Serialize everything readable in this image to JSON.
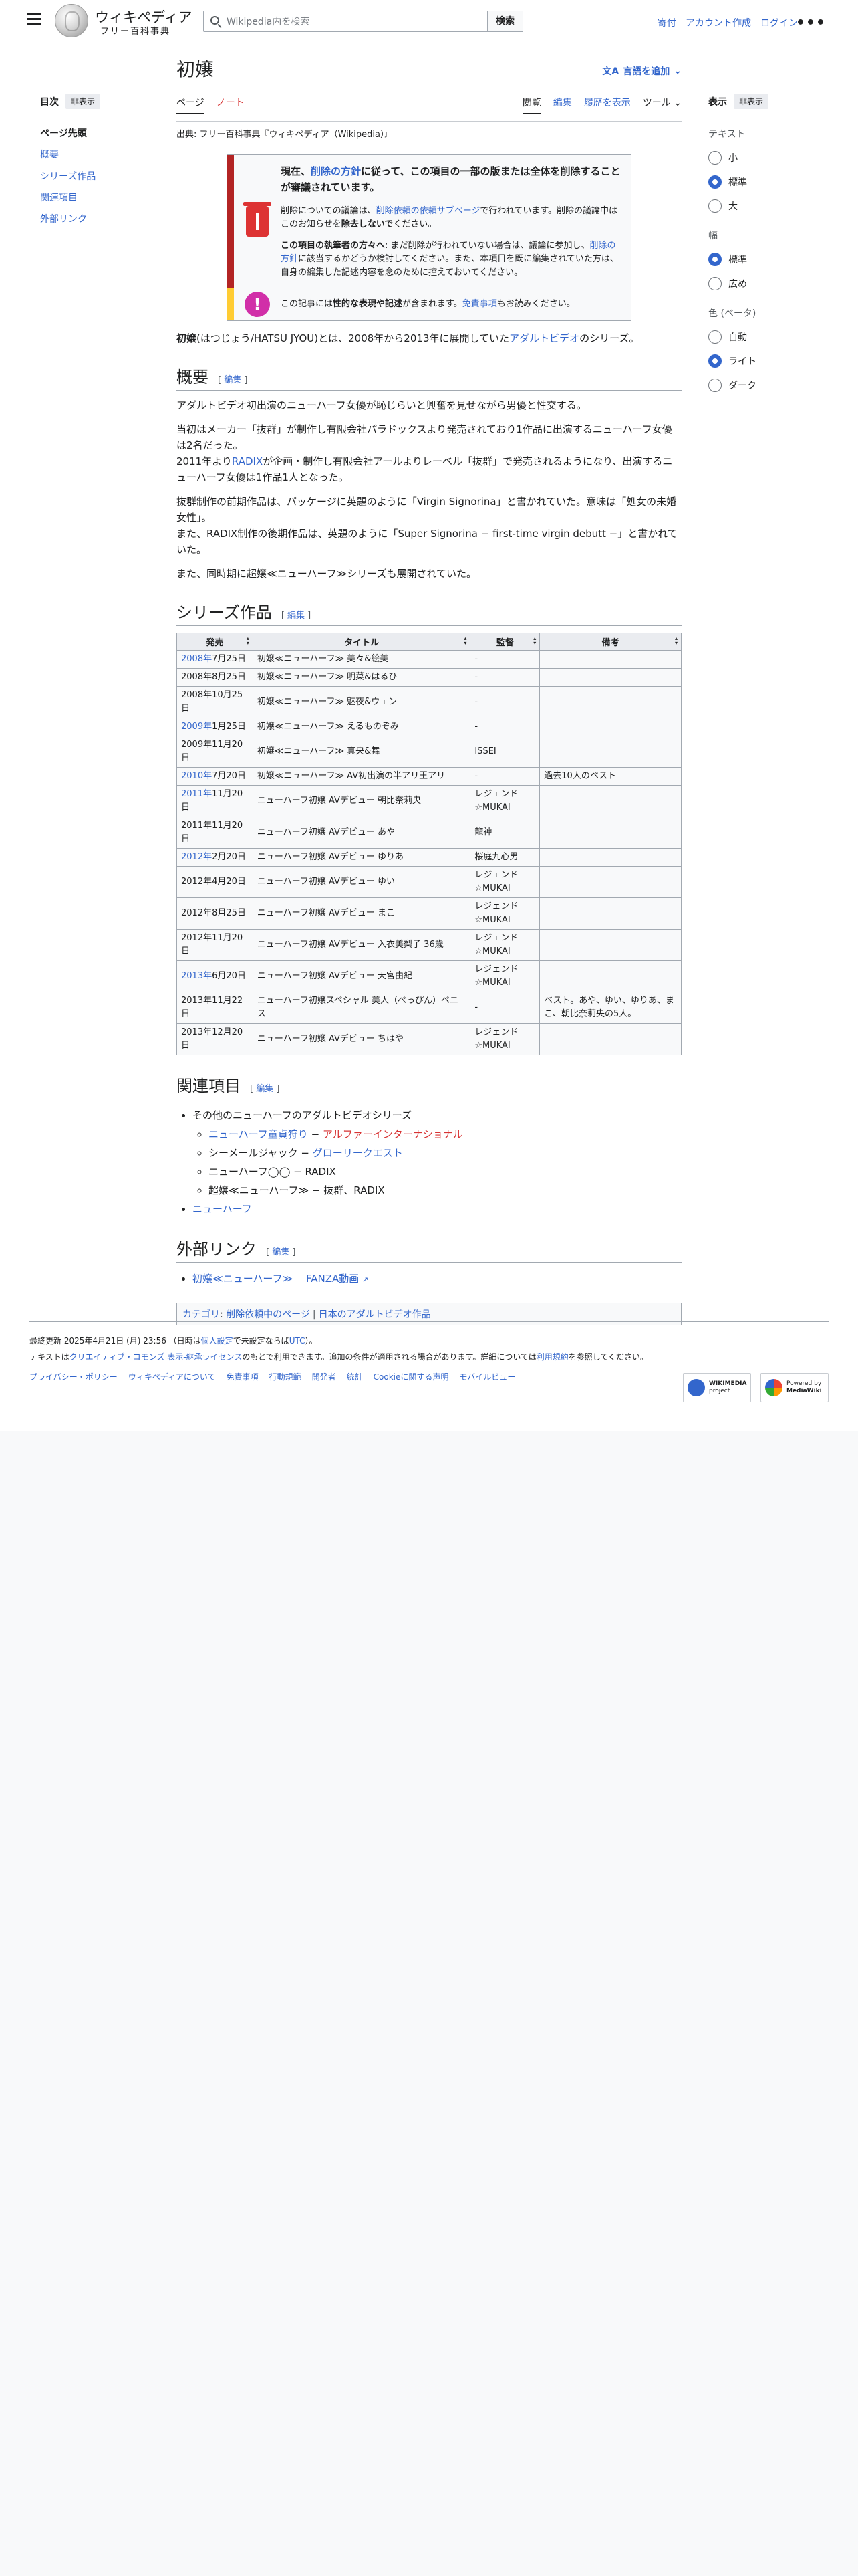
{
  "header": {
    "site_title": "ウィキペディア",
    "site_subtitle": "フリー百科事典",
    "search_placeholder": "Wikipedia内を検索",
    "search_button": "検索",
    "user_links": [
      "寄付",
      "アカウント作成",
      "ログイン"
    ]
  },
  "toc": {
    "title": "目次",
    "hide_label": "非表示",
    "items": [
      "ページ先頭",
      "概要",
      "シリーズ作品",
      "関連項目",
      "外部リンク"
    ]
  },
  "appearance": {
    "title": "表示",
    "hide_label": "非表示",
    "groups": [
      {
        "label": "テキスト",
        "options": [
          "小",
          "標準",
          "大"
        ],
        "selected": "標準"
      },
      {
        "label": "幅",
        "options": [
          "標準",
          "広め"
        ],
        "selected": "標準"
      },
      {
        "label": "色 (ベータ)",
        "options": [
          "自動",
          "ライト",
          "ダーク"
        ],
        "selected": "ライト"
      }
    ]
  },
  "page": {
    "title": "初嬢",
    "lang_button": "言語を追加",
    "tabs_left": [
      "ページ",
      "ノート"
    ],
    "tabs_right": [
      "閲覧",
      "編集",
      "履歴を表示",
      "ツール"
    ],
    "from_line": "出典: フリー百科事典『ウィキペディア（Wikipedia）』"
  },
  "notice": {
    "main_pre": "現在、",
    "main_link": "削除の方針",
    "main_post": "に従って、この項目の一部の版または全体を削除することが審議されています。",
    "p1_pre": "削除についての議論は、",
    "p1_link": "削除依頼の依頼サブページ",
    "p1_post": "で行われています。削除の議論中はこのお知らせを",
    "p1_bold": "除去しないで",
    "p1_end": "ください。",
    "p2_bold": "この項目の執筆者の方々へ",
    "p2_text": ": まだ削除が行われていない場合は、議論に参加し、",
    "p2_link": "削除の方針",
    "p2_end": "に該当するかどうか検討してください。また、本項目を既に編集されていた方は、自身の編集した記述内容を念のために控えておいてください。",
    "p3_pre": "この記事には",
    "p3_bold": "性的な表現や記述",
    "p3_mid": "が含まれます。",
    "p3_link": "免責事項",
    "p3_end": "もお読みください。"
  },
  "intro": {
    "bold": "初嬢",
    "text": "(はつじょう/HATSU JYOU)とは、2008年から2013年に展開していた",
    "link": "アダルトビデオ",
    "end": "のシリーズ。"
  },
  "overview": {
    "heading": "概要",
    "edit": "編集",
    "p1": "アダルトビデオ初出演のニューハーフ女優が恥じらいと興奮を見せながら男優と性交する。",
    "p2a": "当初はメーカー「抜群」が制作し有限会社パラドックスより発売されており1作品に出演するニューハーフ女優は2名だった。",
    "p2b_pre": "2011年より",
    "p2b_link": "RADIX",
    "p2b_post": "が企画・制作し有限会社アールよりレーベル「抜群」で発売されるようになり、出演するニューハーフ女優は1作品1人となった。",
    "p3a": "抜群制作の前期作品は、パッケージに英題のように「Virgin Signorina」と書かれていた。意味は「処女の未婚女性」。",
    "p3b": "また、RADIX制作の後期作品は、英題のように「Super Signorina − first-time virgin debutt −」と書かれていた。",
    "p4": "また、同時期に超嬢≪ニューハーフ≫シリーズも展開されていた。"
  },
  "series": {
    "heading": "シリーズ作品",
    "edit": "編集",
    "columns": [
      "発売",
      "タイトル",
      "監督",
      "備考"
    ],
    "rows": [
      {
        "year": "2008年",
        "year_link": true,
        "date": "7月25日",
        "title": "初嬢≪ニューハーフ≫ 美々&絵美",
        "director": "-",
        "note": ""
      },
      {
        "year": "",
        "year_link": false,
        "date": "2008年8月25日",
        "title": "初嬢≪ニューハーフ≫ 明菜&はるひ",
        "director": "-",
        "note": ""
      },
      {
        "year": "",
        "year_link": false,
        "date": "2008年10月25日",
        "title": "初嬢≪ニューハーフ≫ 魅夜&ウェン",
        "director": "-",
        "note": ""
      },
      {
        "year": "2009年",
        "year_link": true,
        "date": "1月25日",
        "title": "初嬢≪ニューハーフ≫ えるものぞみ",
        "director": "-",
        "note": ""
      },
      {
        "year": "",
        "year_link": false,
        "date": "2009年11月20日",
        "title": "初嬢≪ニューハーフ≫ 真央&舞",
        "director": "ISSEI",
        "note": ""
      },
      {
        "year": "2010年",
        "year_link": true,
        "date": "7月20日",
        "title": "初嬢≪ニューハーフ≫ AV初出演の半アリ王アリ",
        "director": "-",
        "note": "過去10人のベスト"
      },
      {
        "year": "2011年",
        "year_link": true,
        "date": "11月20日",
        "title": "ニューハーフ初嬢 AVデビュー 朝比奈莉央",
        "director": "レジェンド☆MUKAI",
        "note": ""
      },
      {
        "year": "",
        "year_link": false,
        "date": "2011年11月20日",
        "title": "ニューハーフ初嬢 AVデビュー あや",
        "director": "龍神",
        "note": ""
      },
      {
        "year": "2012年",
        "year_link": true,
        "date": "2月20日",
        "title": "ニューハーフ初嬢 AVデビュー ゆりあ",
        "director": "桜庭九心男",
        "note": ""
      },
      {
        "year": "",
        "year_link": false,
        "date": "2012年4月20日",
        "title": "ニューハーフ初嬢 AVデビュー ゆい",
        "director": "レジェンド☆MUKAI",
        "note": ""
      },
      {
        "year": "",
        "year_link": false,
        "date": "2012年8月25日",
        "title": "ニューハーフ初嬢 AVデビュー まこ",
        "director": "レジェンド☆MUKAI",
        "note": ""
      },
      {
        "year": "",
        "year_link": false,
        "date": "2012年11月20日",
        "title": "ニューハーフ初嬢 AVデビュー 入衣美梨子 36歳",
        "director": "レジェンド☆MUKAI",
        "note": ""
      },
      {
        "year": "2013年",
        "year_link": true,
        "date": "6月20日",
        "title": "ニューハーフ初嬢 AVデビュー 天宮由紀",
        "director": "レジェンド☆MUKAI",
        "note": ""
      },
      {
        "year": "",
        "year_link": false,
        "date": "2013年11月22日",
        "title": "ニューハーフ初嬢スペシャル 美人（ぺっぴん）ペニス",
        "director": "-",
        "note": "ベスト。あや、ゆい、ゆりあ、まこ、朝比奈莉央の5人。"
      },
      {
        "year": "",
        "year_link": false,
        "date": "2013年12月20日",
        "title": "ニューハーフ初嬢 AVデビュー ちはや",
        "director": "レジェンド☆MUKAI",
        "note": ""
      }
    ]
  },
  "related": {
    "heading": "関連項目",
    "edit": "編集",
    "item1": "その他のニューハーフのアダルトビデオシリーズ",
    "sub1_link": "ニューハーフ童貞狩り",
    "sub1_dash": " − ",
    "sub1_red": "アルファーインターナショナル",
    "sub2_text": "シーメールジャック − ",
    "sub2_link": "グローリークエスト",
    "sub3": "ニューハーフ◯◯ − RADIX",
    "sub4": "超嬢≪ニューハーフ≫ − 抜群、RADIX",
    "item2_link": "ニューハーフ"
  },
  "external": {
    "heading": "外部リンク",
    "edit": "編集",
    "link": "初嬢≪ニューハーフ≫ ｜FANZA動画"
  },
  "categories": {
    "label": "カテゴリ",
    "items": [
      "削除依頼中のページ",
      "日本のアダルトビデオ作品"
    ]
  },
  "footer": {
    "updated_pre": "最終更新 2025年4月21日 (月) 23:56 （日時は",
    "updated_link1": "個人設定",
    "updated_mid": "で未設定ならば",
    "updated_link2": "UTC",
    "updated_end": "）。",
    "license_pre": "テキストは",
    "license_link": "クリエイティブ・コモンズ 表示-継承ライセンス",
    "license_mid": "のもとで利用できます。追加の条件が適用される場合があります。詳細については",
    "license_link2": "利用規約",
    "license_end": "を参照してください。",
    "links": [
      "プライバシー・ポリシー",
      "ウィキペディアについて",
      "免責事項",
      "行動規範",
      "開発者",
      "統計",
      "Cookieに関する声明",
      "モバイルビュー"
    ],
    "badge1_top": "WIKIMEDIA",
    "badge1_bottom": "project",
    "badge2_top": "Powered by",
    "badge2_bottom": "MediaWiki"
  }
}
